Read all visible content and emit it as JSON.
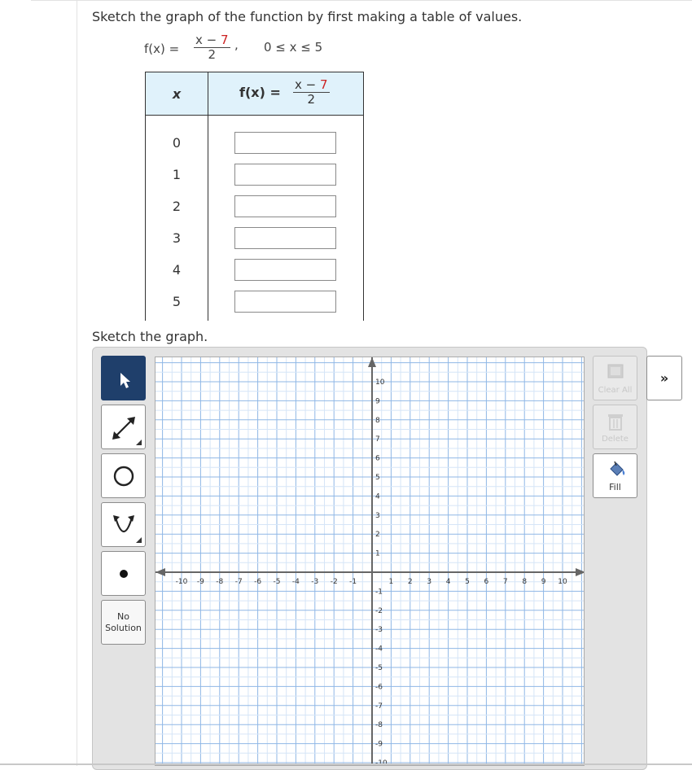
{
  "problem": {
    "instruction": "Sketch the graph of the function by first making a table of values.",
    "function_name": "f(x) =",
    "numerator_x": "x − ",
    "numerator_const": "7",
    "denominator": "2",
    "comma": ",",
    "domain": "0 ≤ x ≤ 5"
  },
  "table": {
    "header_x": "x",
    "header_f": "f(x) =",
    "header_numerator_x": "x − ",
    "header_numerator_const": "7",
    "header_denominator": "2",
    "rows": [
      {
        "x": "0",
        "value": ""
      },
      {
        "x": "1",
        "value": ""
      },
      {
        "x": "2",
        "value": ""
      },
      {
        "x": "3",
        "value": ""
      },
      {
        "x": "4",
        "value": ""
      },
      {
        "x": "5",
        "value": ""
      }
    ]
  },
  "graph_section": {
    "label": "Sketch the graph.",
    "tools": [
      {
        "name": "select-arrow-icon",
        "active": true
      },
      {
        "name": "line-tool-icon",
        "active": false
      },
      {
        "name": "circle-tool-icon",
        "active": false
      },
      {
        "name": "parabola-tool-icon",
        "active": false
      },
      {
        "name": "point-tool-icon",
        "active": false
      }
    ],
    "no_solution_line1": "No",
    "no_solution_line2": "Solution",
    "clear_all": "Clear All",
    "delete": "Delete",
    "fill": "Fill",
    "expand": "»",
    "axis_x_labels": [
      "-10",
      "-9",
      "-8",
      "-7",
      "-6",
      "-5",
      "-4",
      "-3",
      "-2",
      "-1",
      "1",
      "2",
      "3",
      "4",
      "5",
      "6",
      "7",
      "8",
      "9",
      "10"
    ],
    "axis_y_labels": [
      "10",
      "9",
      "8",
      "7",
      "6",
      "5",
      "4",
      "3",
      "2",
      "1",
      "-1",
      "-2",
      "-3",
      "-4",
      "-5",
      "-6",
      "-7",
      "-8",
      "-9",
      "-10"
    ],
    "colors": {
      "grid_major": "#8fb7e6",
      "grid_minor": "#d6e5f7",
      "axis": "#666666",
      "active_tool": "#1f3f6b",
      "highlight": "#cc2222"
    }
  }
}
